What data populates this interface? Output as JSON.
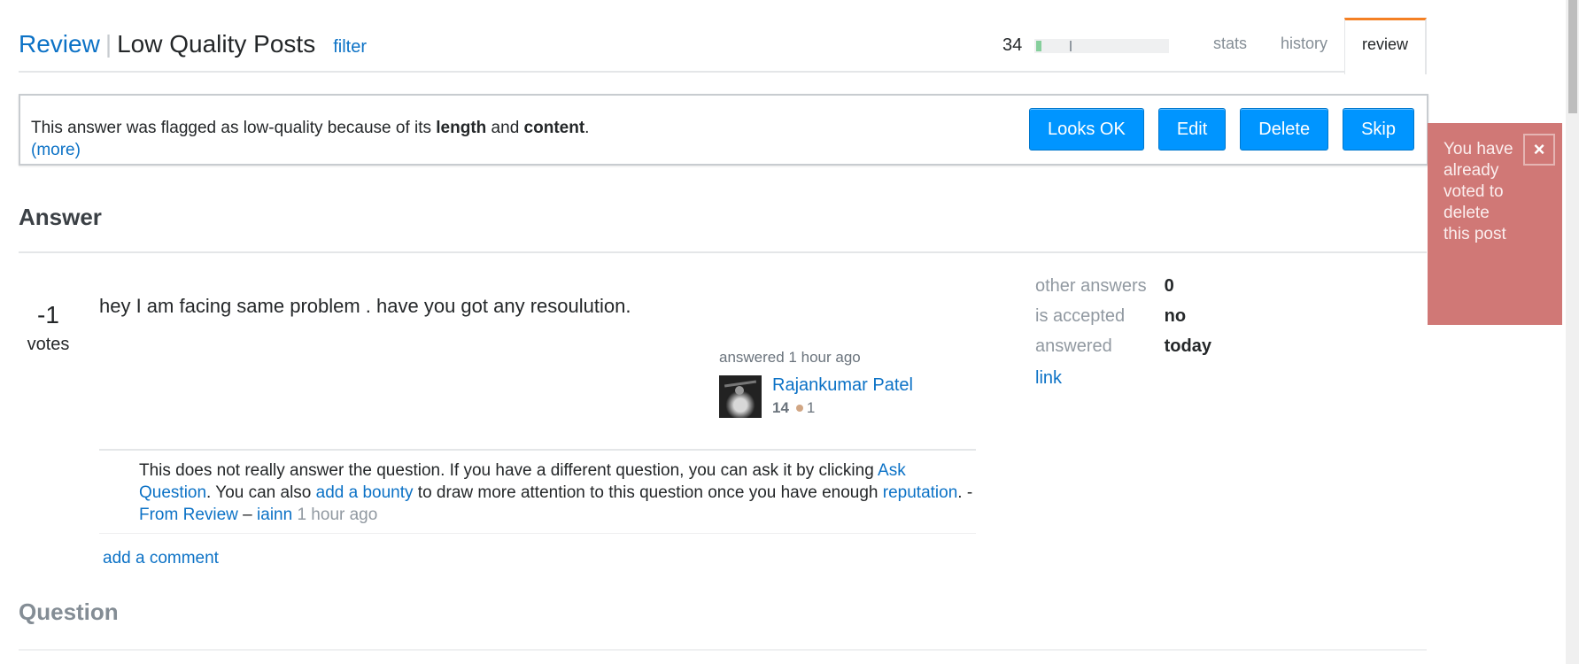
{
  "header": {
    "breadcrumb_root": "Review",
    "separator": "|",
    "queue_title": "Low Quality Posts",
    "filter_label": "filter",
    "review_count": "34",
    "progress": {
      "completed_fraction": 0.04,
      "marker_fraction": 0.26
    },
    "tabs": [
      {
        "label": "stats",
        "active": false
      },
      {
        "label": "history",
        "active": false
      },
      {
        "label": "review",
        "active": true
      }
    ]
  },
  "flag_notice": {
    "prefix": "This answer was flagged as low-quality because of its ",
    "reason1": "length",
    "middle": " and ",
    "reason2": "content",
    "suffix": ".",
    "more_link": "(more)"
  },
  "actions": {
    "looks_ok": "Looks OK",
    "edit": "Edit",
    "delete": "Delete",
    "skip": "Skip"
  },
  "answer": {
    "heading": "Answer",
    "votes": "-1",
    "votes_label": "votes",
    "body": "hey I am facing same problem . have you got any resoulution.",
    "action_time": "answered 1 hour ago",
    "user": {
      "name": "Rajankumar Patel",
      "reputation": "14",
      "bronze_badges": "1",
      "bronze_color": "#d1a684"
    },
    "comment": {
      "text1": "This does not really answer the question. If you have a different question, you can ask it by clicking ",
      "link_ask": "Ask Question",
      "text2": ". You can also ",
      "link_bounty": "add a bounty",
      "text3": " to draw more attention to this question once you have enough ",
      "link_reputation": "reputation",
      "text4": ". - ",
      "link_review": "From Review",
      "dash": " – ",
      "author": "iainn",
      "time": " 1 hour ago"
    },
    "add_comment": "add a comment"
  },
  "stats": {
    "rows": [
      {
        "key": "other answers",
        "value": "0"
      },
      {
        "key": "is accepted",
        "value": "no"
      },
      {
        "key": "answered",
        "value": "today"
      }
    ],
    "link": "link"
  },
  "question": {
    "heading": "Question"
  },
  "notification": {
    "text": "You have already voted to delete this post",
    "close": "×",
    "color": "#d07876"
  }
}
